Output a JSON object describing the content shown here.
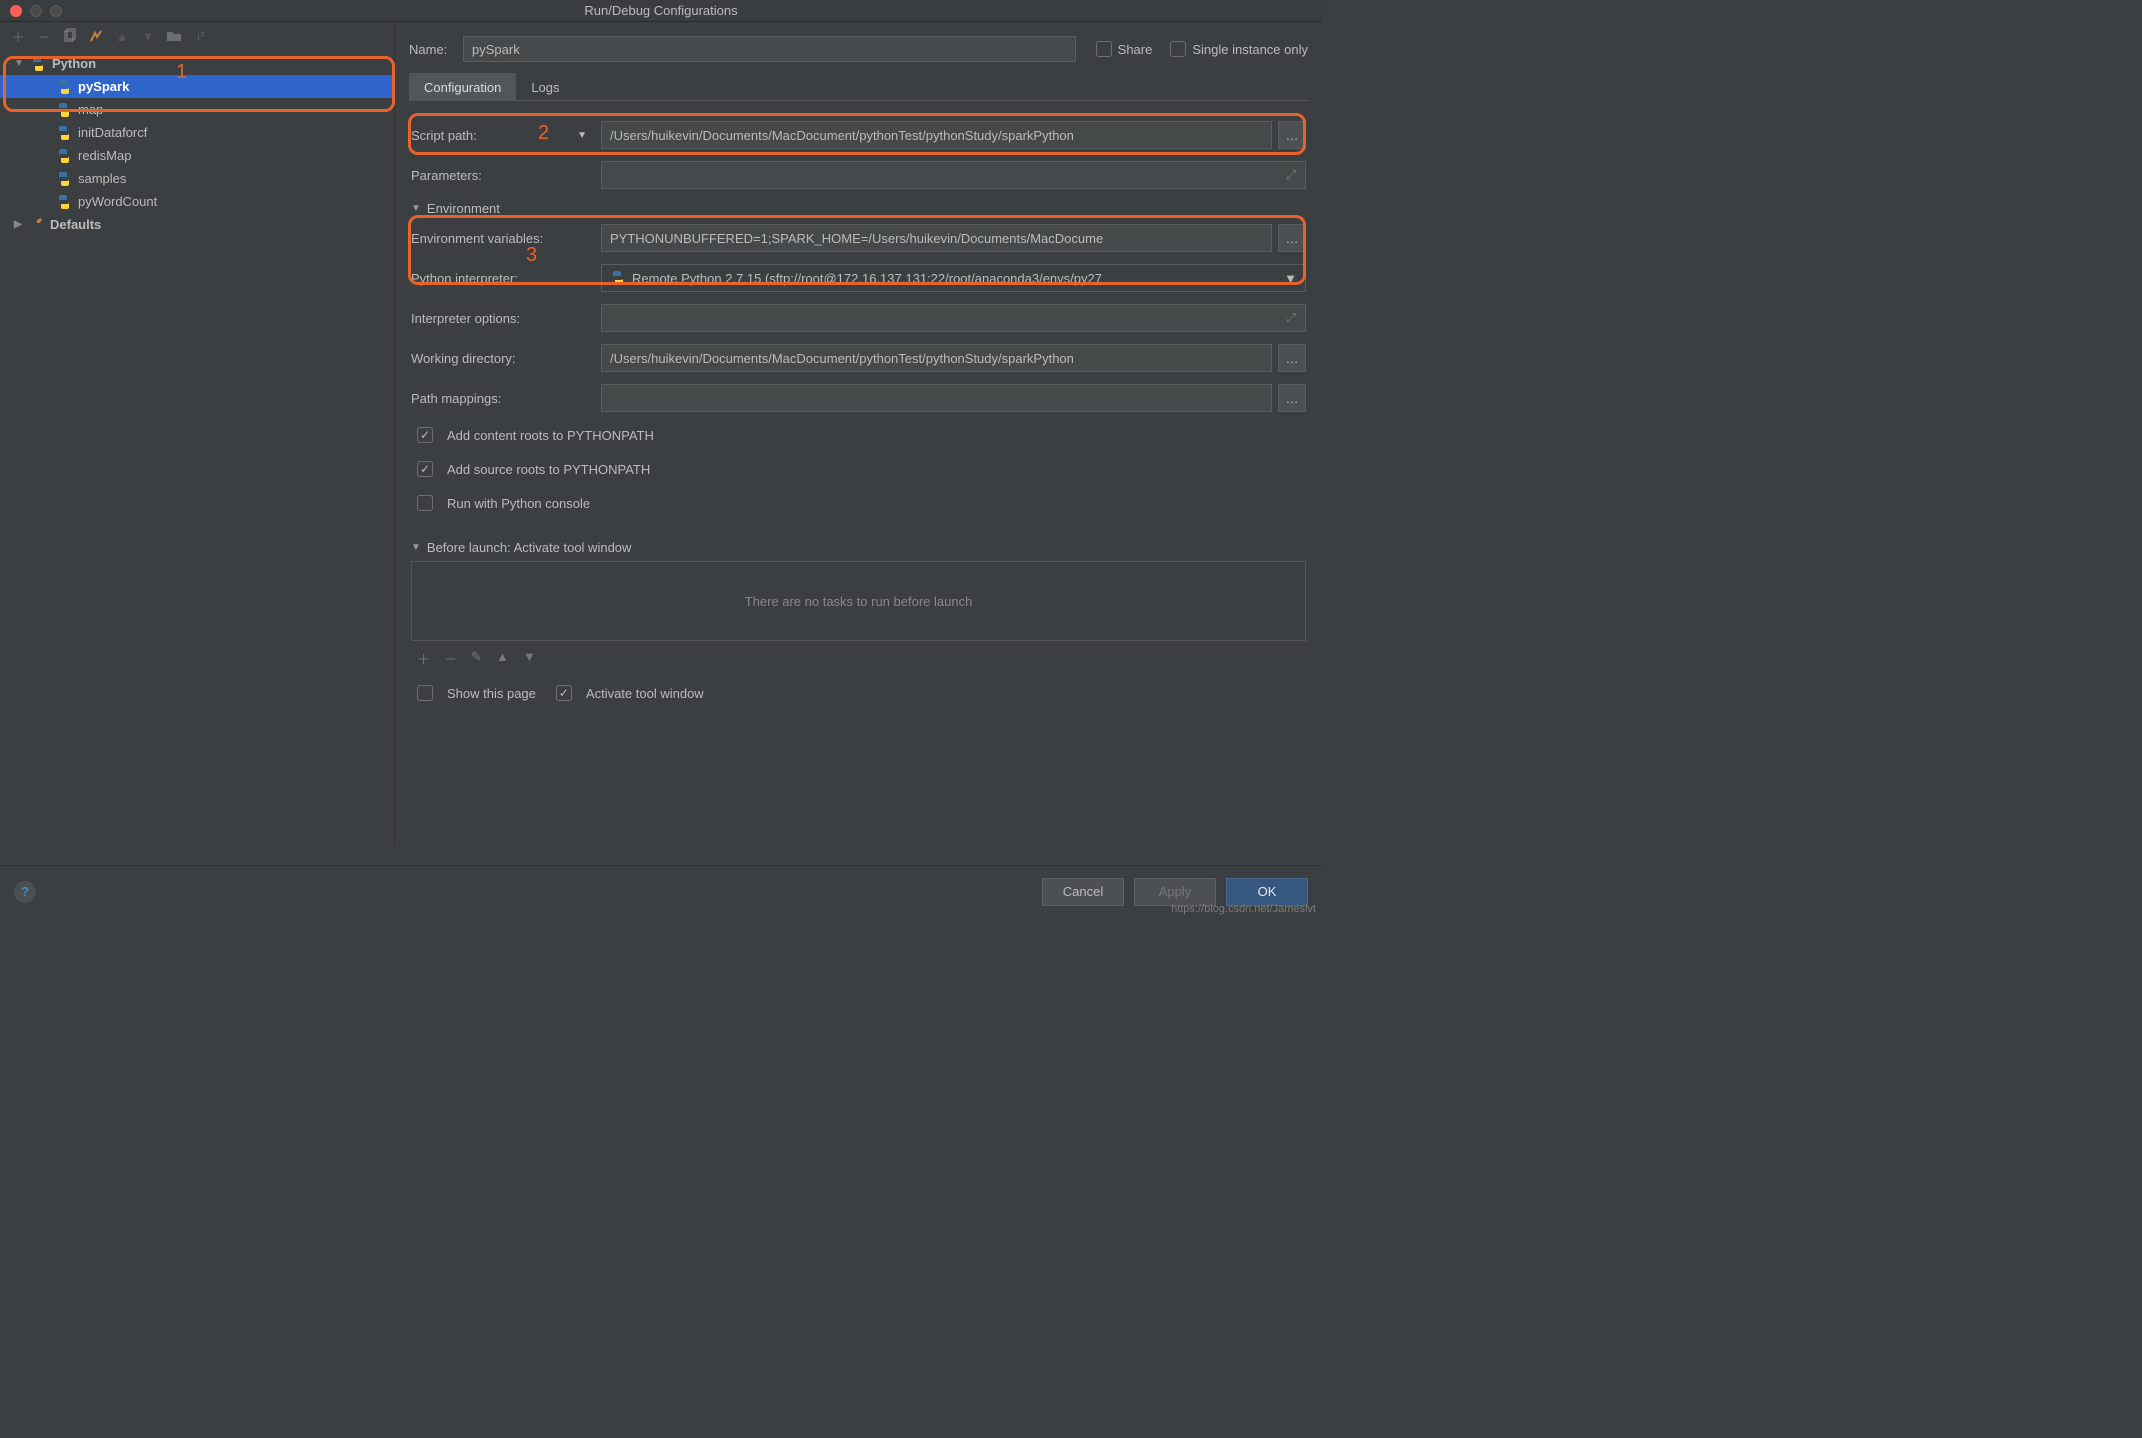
{
  "window": {
    "title": "Run/Debug Configurations"
  },
  "sidebar": {
    "root_label": "Python",
    "defaults_label": "Defaults",
    "items": [
      {
        "label": "pySpark",
        "selected": true
      },
      {
        "label": "map"
      },
      {
        "label": "initDataforcf"
      },
      {
        "label": "redisMap"
      },
      {
        "label": "samples"
      },
      {
        "label": "pyWordCount"
      }
    ]
  },
  "header": {
    "name_label": "Name:",
    "name_value": "pySpark",
    "share_label": "Share",
    "single_instance_label": "Single instance only"
  },
  "tabs": {
    "configuration": "Configuration",
    "logs": "Logs"
  },
  "config": {
    "script_path_label": "Script path:",
    "script_path_value": "/Users/huikevin/Documents/MacDocument/pythonTest/pythonStudy/sparkPython",
    "parameters_label": "Parameters:",
    "parameters_value": "",
    "env_section": "Environment",
    "env_vars_label": "Environment variables:",
    "env_vars_value": "PYTHONUNBUFFERED=1;SPARK_HOME=/Users/huikevin/Documents/MacDocume",
    "interpreter_label": "Python interpreter:",
    "interpreter_value": "Remote Python 2.7.15 (sftp://root@172.16.137.131:22/root/anaconda3/envs/py27",
    "interpreter_options_label": "Interpreter options:",
    "interpreter_options_value": "",
    "working_dir_label": "Working directory:",
    "working_dir_value": "/Users/huikevin/Documents/MacDocument/pythonTest/pythonStudy/sparkPython",
    "path_mappings_label": "Path mappings:",
    "path_mappings_value": "",
    "add_content_roots": "Add content roots to PYTHONPATH",
    "add_source_roots": "Add source roots to PYTHONPATH",
    "run_with_console": "Run with Python console"
  },
  "before_launch": {
    "header": "Before launch: Activate tool window",
    "empty_text": "There are no tasks to run before launch",
    "show_page": "Show this page",
    "activate_tool": "Activate tool window"
  },
  "footer": {
    "cancel": "Cancel",
    "apply": "Apply",
    "ok": "OK"
  },
  "annotations": {
    "n1": "1",
    "n2": "2",
    "n3": "3"
  },
  "watermark": "https://blog.csdn.net/Jameslvt"
}
